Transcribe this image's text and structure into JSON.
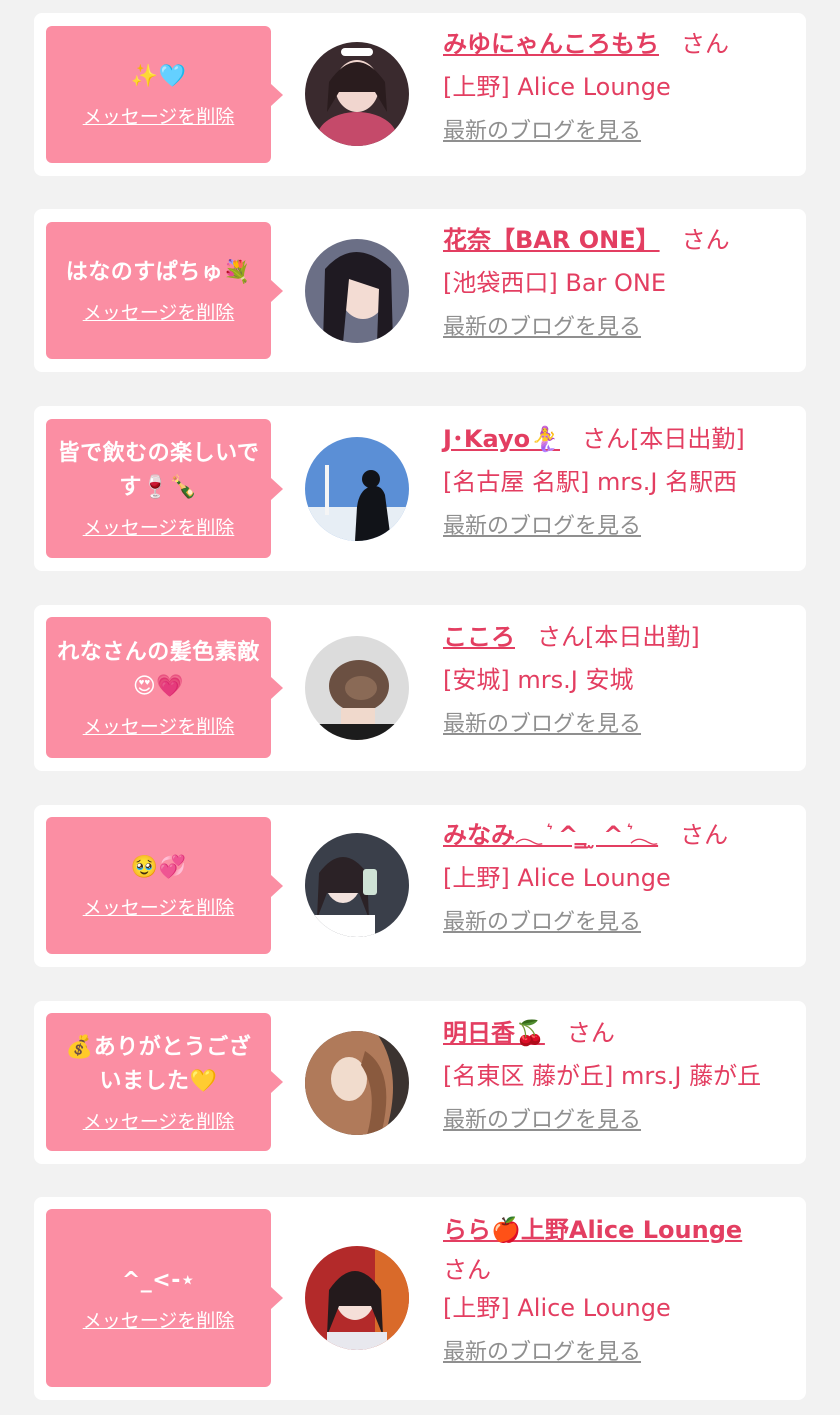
{
  "accent": "#e33e61",
  "bubble_color": "#fb8ea3",
  "items": [
    {
      "message": "✨🩵",
      "delete_label": "メッセージを削除",
      "name": "みゆにゃんころもち",
      "honorific": "さん",
      "status": "",
      "shop": "[上野] Alice Lounge",
      "blog_label": "最新のブログを見る"
    },
    {
      "message": "はなのすぱちゅ💐",
      "delete_label": "メッセージを削除",
      "name": "花奈【BAR ONE】",
      "honorific": "さん",
      "status": "",
      "shop": "[池袋西口] Bar ONE",
      "blog_label": "最新のブログを見る"
    },
    {
      "message": "皆で飲むの楽しいです🍷🍾",
      "delete_label": "メッセージを削除",
      "name": "J･Kayo🧜‍♀️",
      "honorific": "さん",
      "status": "[本日出勤]",
      "shop": "[名古屋 名駅] mrs.J 名駅西",
      "blog_label": "最新のブログを見る"
    },
    {
      "message": "れなさんの髪色素敵😍💗",
      "delete_label": "メッセージを削除",
      "name": "こころ",
      "honorific": "さん",
      "status": "[本日出勤]",
      "shop": "[安城] mrs.J 安城",
      "blog_label": "最新のブログを見る"
    },
    {
      "message": "🥹💞",
      "delete_label": "メッセージを削除",
      "name": "みなみ𓂃 ͛ ^ ̳ ̫ ^ ͛𓂃",
      "honorific": "さん",
      "status": "",
      "shop": "[上野] Alice Lounge",
      "blog_label": "最新のブログを見る"
    },
    {
      "message": "💰ありがとうございました💛",
      "delete_label": "メッセージを削除",
      "name": "明日香🍒",
      "honorific": "さん",
      "status": "",
      "shop": "[名東区 藤が丘] mrs.J 藤が丘",
      "blog_label": "最新のブログを見る"
    },
    {
      "message": "^_<-⋆",
      "delete_label": "メッセージを削除",
      "name": "らら🍎上野Alice Lounge",
      "honorific": "さん",
      "status": "",
      "shop": "[上野] Alice Lounge",
      "blog_label": "最新のブログを見る"
    }
  ]
}
